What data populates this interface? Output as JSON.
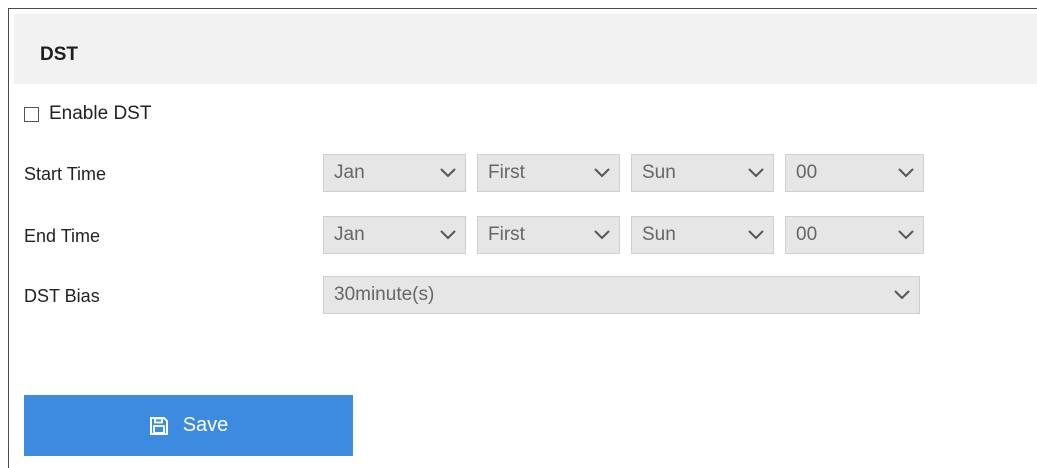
{
  "section": {
    "title": "DST"
  },
  "enable_dst": {
    "label": "Enable DST",
    "checked": false
  },
  "start_time": {
    "label": "Start Time",
    "month": "Jan",
    "week": "First",
    "day": "Sun",
    "hour": "00"
  },
  "end_time": {
    "label": "End Time",
    "month": "Jan",
    "week": "First",
    "day": "Sun",
    "hour": "00"
  },
  "dst_bias": {
    "label": "DST Bias",
    "value": "30minute(s)"
  },
  "save": {
    "label": "Save",
    "icon": "save-icon"
  },
  "colors": {
    "accent": "#3d8be0",
    "header_bg": "#f2f2f2",
    "select_bg": "#e6e6e6"
  }
}
